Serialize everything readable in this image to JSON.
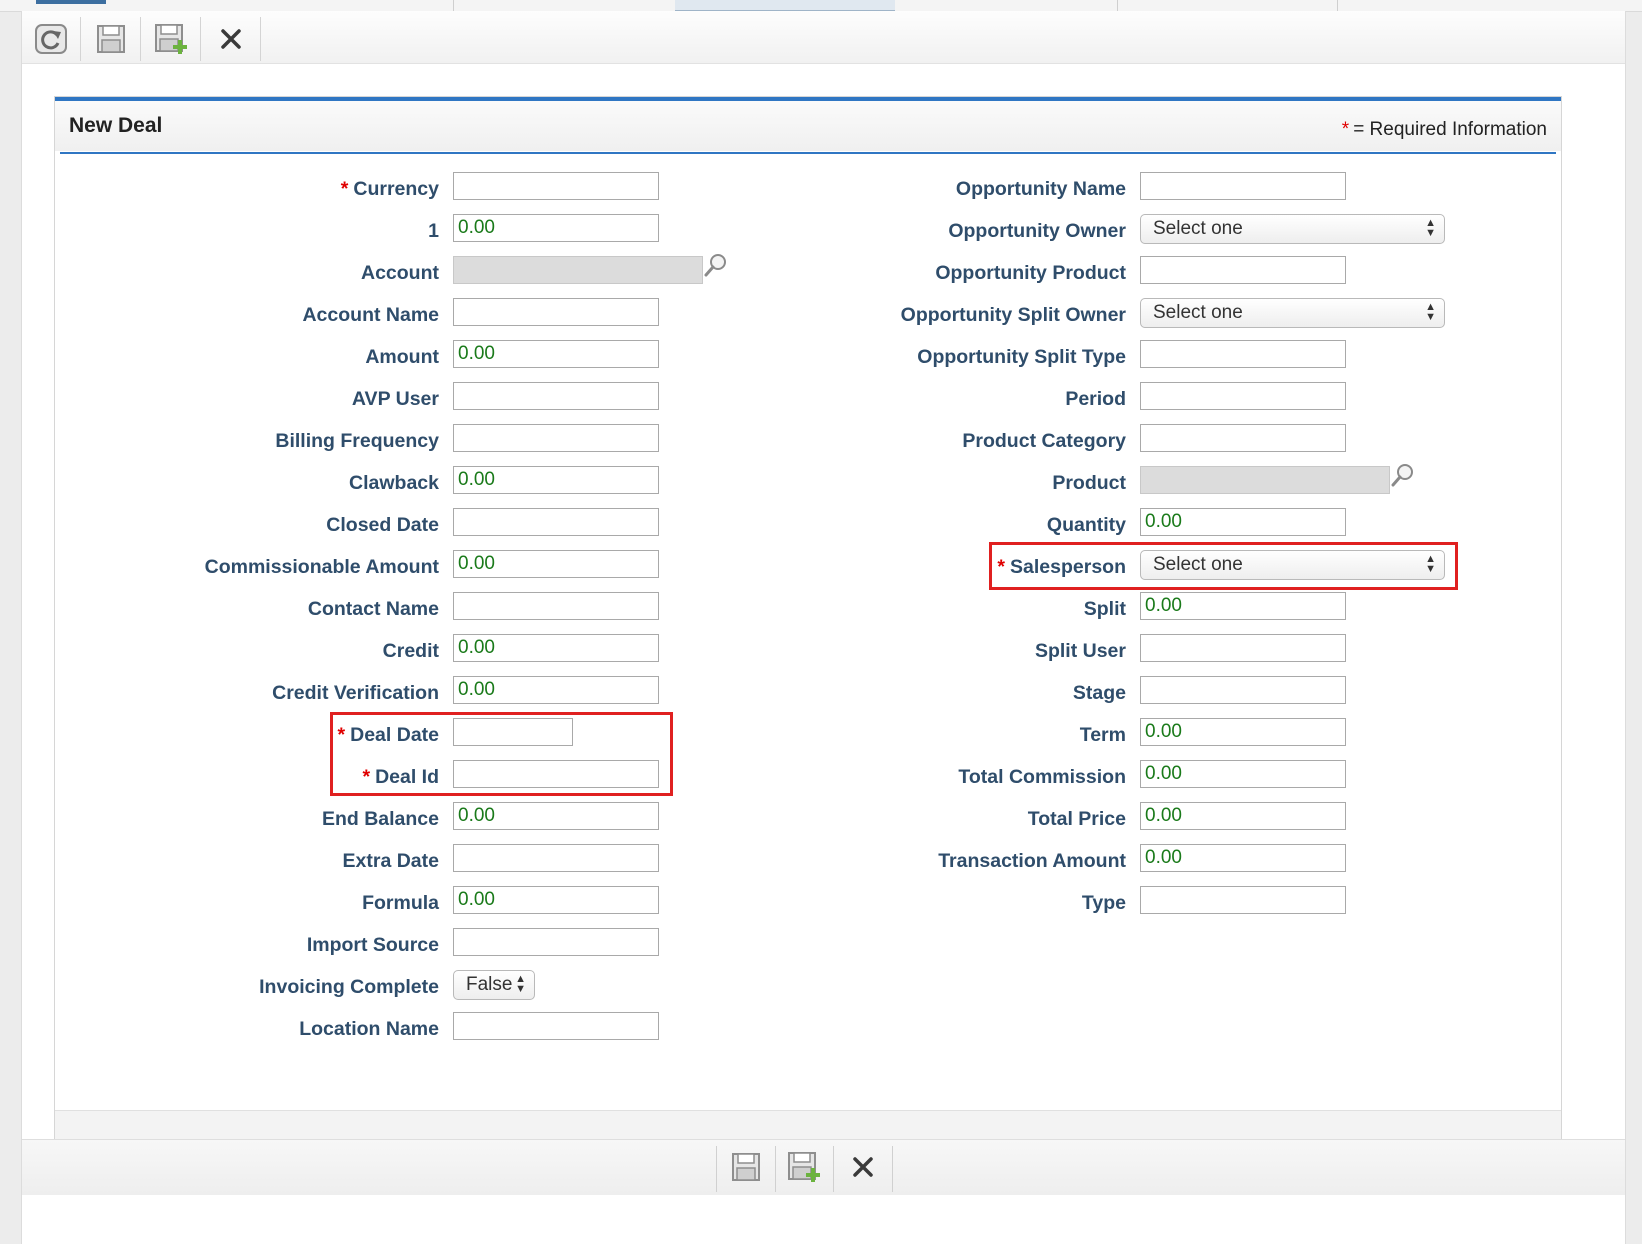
{
  "window": {
    "toolbar": {
      "buttons": [
        {
          "icon": "refresh-icon"
        },
        {
          "icon": "save-icon"
        },
        {
          "icon": "save-new-icon"
        },
        {
          "icon": "close-icon"
        }
      ]
    }
  },
  "form": {
    "title": "New Deal",
    "required_star": "*",
    "required_note": "= Required Information",
    "left_fields": [
      {
        "label": "Currency",
        "required": true,
        "type": "text",
        "value": ""
      },
      {
        "label": "1",
        "required": false,
        "type": "text",
        "value": "0.00"
      },
      {
        "label": "Account",
        "required": false,
        "type": "lookup",
        "value": ""
      },
      {
        "label": "Account Name",
        "required": false,
        "type": "text",
        "value": ""
      },
      {
        "label": "Amount",
        "required": false,
        "type": "text",
        "value": "0.00"
      },
      {
        "label": "AVP User",
        "required": false,
        "type": "text",
        "value": ""
      },
      {
        "label": "Billing Frequency",
        "required": false,
        "type": "text",
        "value": ""
      },
      {
        "label": "Clawback",
        "required": false,
        "type": "text",
        "value": "0.00"
      },
      {
        "label": "Closed Date",
        "required": false,
        "type": "text",
        "value": ""
      },
      {
        "label": "Commissionable Amount",
        "required": false,
        "type": "text",
        "value": "0.00"
      },
      {
        "label": "Contact Name",
        "required": false,
        "type": "text",
        "value": ""
      },
      {
        "label": "Credit",
        "required": false,
        "type": "text",
        "value": "0.00"
      },
      {
        "label": "Credit Verification",
        "required": false,
        "type": "text",
        "value": "0.00"
      },
      {
        "label": "Deal Date",
        "required": true,
        "type": "date",
        "value": ""
      },
      {
        "label": "Deal Id",
        "required": true,
        "type": "text",
        "value": ""
      },
      {
        "label": "End Balance",
        "required": false,
        "type": "text",
        "value": "0.00"
      },
      {
        "label": "Extra Date",
        "required": false,
        "type": "text",
        "value": ""
      },
      {
        "label": "Formula",
        "required": false,
        "type": "text",
        "value": "0.00"
      },
      {
        "label": "Import Source",
        "required": false,
        "type": "text",
        "value": ""
      },
      {
        "label": "Invoicing Complete",
        "required": false,
        "type": "select",
        "value": "False"
      },
      {
        "label": "Location Name",
        "required": false,
        "type": "text",
        "value": ""
      }
    ],
    "right_fields": [
      {
        "label": "Opportunity Name",
        "required": false,
        "type": "text",
        "value": ""
      },
      {
        "label": "Opportunity Owner",
        "required": false,
        "type": "select",
        "value": "Select one"
      },
      {
        "label": "Opportunity Product",
        "required": false,
        "type": "text",
        "value": ""
      },
      {
        "label": "Opportunity Split Owner",
        "required": false,
        "type": "select",
        "value": "Select one"
      },
      {
        "label": "Opportunity Split Type",
        "required": false,
        "type": "text",
        "value": ""
      },
      {
        "label": "Period",
        "required": false,
        "type": "text",
        "value": ""
      },
      {
        "label": "Product Category",
        "required": false,
        "type": "text",
        "value": ""
      },
      {
        "label": "Product",
        "required": false,
        "type": "lookup",
        "value": ""
      },
      {
        "label": "Quantity",
        "required": false,
        "type": "text",
        "value": "0.00"
      },
      {
        "label": "Salesperson",
        "required": true,
        "type": "select",
        "value": "Select one"
      },
      {
        "label": "Split",
        "required": false,
        "type": "text",
        "value": "0.00"
      },
      {
        "label": "Split User",
        "required": false,
        "type": "text",
        "value": ""
      },
      {
        "label": "Stage",
        "required": false,
        "type": "text",
        "value": ""
      },
      {
        "label": "Term",
        "required": false,
        "type": "text",
        "value": "0.00"
      },
      {
        "label": "Total Commission",
        "required": false,
        "type": "text",
        "value": "0.00"
      },
      {
        "label": "Total Price",
        "required": false,
        "type": "text",
        "value": "0.00"
      },
      {
        "label": "Transaction Amount",
        "required": false,
        "type": "text",
        "value": "0.00"
      },
      {
        "label": "Type",
        "required": false,
        "type": "text",
        "value": ""
      }
    ],
    "highlighted_fields": [
      "Deal Date",
      "Deal Id",
      "Salesperson"
    ]
  },
  "bottom_toolbar": {
    "buttons": [
      {
        "icon": "save-icon"
      },
      {
        "icon": "save-new-icon"
      },
      {
        "icon": "close-icon"
      }
    ]
  },
  "colors": {
    "accent": "#2f76c3",
    "label": "#2f4d6b",
    "value": "#1a7a1a",
    "required": "#e00000",
    "highlight": "#e02020"
  }
}
